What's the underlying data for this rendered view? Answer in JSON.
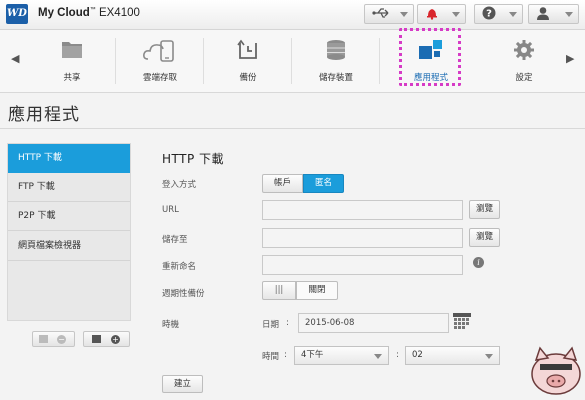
{
  "header": {
    "brand_logo_text": "WD",
    "app_name": "My Cloud",
    "trademark": "™",
    "model": "EX4100"
  },
  "nav": {
    "items": [
      {
        "label": "共享",
        "icon": "folder-icon"
      },
      {
        "label": "雲端存取",
        "icon": "cloud-devices-icon"
      },
      {
        "label": "備份",
        "icon": "backup-clock-icon"
      },
      {
        "label": "儲存裝置",
        "icon": "storage-disks-icon"
      },
      {
        "label": "應用程式",
        "icon": "apps-grid-icon",
        "active": true
      },
      {
        "label": "設定",
        "icon": "gear-icon"
      }
    ]
  },
  "page": {
    "title": "應用程式"
  },
  "sidebar": {
    "items": [
      {
        "label": "HTTP 下載",
        "active": true
      },
      {
        "label": "FTP 下載"
      },
      {
        "label": "P2P 下載"
      },
      {
        "label": "網頁檔案檢視器"
      }
    ]
  },
  "form": {
    "title": "HTTP 下載",
    "login_label": "登入方式",
    "login_options": [
      "帳戶",
      "匿名"
    ],
    "login_selected": "匿名",
    "url_label": "URL",
    "url_value": "",
    "browse_url_label": "瀏覽",
    "save_to_label": "儲存至",
    "save_to_value": "",
    "browse_save_label": "瀏覽",
    "rename_label": "重新命名",
    "rename_value": "",
    "periodic_label": "週期性備份",
    "toggle_state": "關閉",
    "toggle_handle": "|||",
    "time_label": "時機",
    "date_label": "日期",
    "date_value": "2015-06-08",
    "clock_label": "時間",
    "hour_value": "4下午",
    "minute_value": "02",
    "create_label": "建立",
    "colon": ":"
  },
  "colors": {
    "accent": "#1b9ddb",
    "highlight": "#d63bc6",
    "alert": "#d9262c"
  }
}
